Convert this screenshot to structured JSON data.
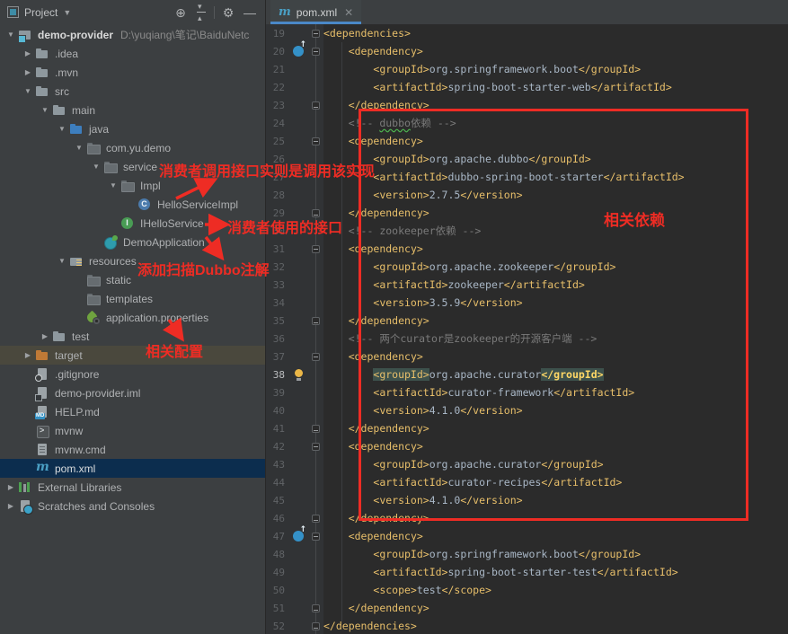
{
  "colors": {
    "panel_bg": "#3c3f41",
    "editor_bg": "#2b2b2b",
    "gutter_bg": "#313335",
    "annotation_red": "#EE2C24",
    "tab_underline": "#4A88C7",
    "tree_selection_bg": "#0C2D4E",
    "tree_highlight_row_bg": "#4A483D",
    "xml_tag_color": "#E8BF6A",
    "xml_text_color": "#A9B7C6",
    "comment_color": "#7A7A7A",
    "matched_tag_bg": "#3D514C",
    "maven_icon_color": "#4A9FC4"
  },
  "toolbar": {
    "project_label": "Project"
  },
  "tab": {
    "title": "pom.xml"
  },
  "tree": {
    "items": [
      {
        "label": "demo-provider",
        "path": "D:\\yuqiang\\笔记\\BaiduNetc",
        "level": 0,
        "exp": "v",
        "icon": "project-folder",
        "bold": true
      },
      {
        "label": ".idea",
        "level": 1,
        "exp": ">",
        "icon": "folder"
      },
      {
        "label": ".mvn",
        "level": 1,
        "exp": ">",
        "icon": "folder"
      },
      {
        "label": "src",
        "level": 1,
        "exp": "v",
        "icon": "folder"
      },
      {
        "label": "main",
        "level": 2,
        "exp": "v",
        "icon": "folder"
      },
      {
        "label": "java",
        "level": 3,
        "exp": "v",
        "icon": "source-folder"
      },
      {
        "label": "com.yu.demo",
        "level": 4,
        "exp": "v",
        "icon": "package"
      },
      {
        "label": "service",
        "level": 5,
        "exp": "v",
        "icon": "package"
      },
      {
        "label": "Impl",
        "level": 6,
        "exp": "v",
        "icon": "package"
      },
      {
        "label": "HelloServiceImpl",
        "level": 7,
        "exp": "",
        "icon": "class"
      },
      {
        "label": "IHelloService",
        "level": 6,
        "exp": "",
        "icon": "interface"
      },
      {
        "label": "DemoApplication",
        "level": 5,
        "exp": "",
        "icon": "springboot-class"
      },
      {
        "label": "resources",
        "level": 3,
        "exp": "v",
        "icon": "resources-folder"
      },
      {
        "label": "static",
        "level": 4,
        "exp": "",
        "icon": "package"
      },
      {
        "label": "templates",
        "level": 4,
        "exp": "",
        "icon": "package"
      },
      {
        "label": "application.properties",
        "level": 4,
        "exp": "",
        "icon": "spring-properties"
      },
      {
        "label": "test",
        "level": 2,
        "exp": ">",
        "icon": "folder"
      },
      {
        "label": "target",
        "level": 1,
        "exp": ">",
        "icon": "excluded-folder",
        "hl": true
      },
      {
        "label": ".gitignore",
        "level": 1,
        "exp": "",
        "icon": "gitignore-file"
      },
      {
        "label": "demo-provider.iml",
        "level": 1,
        "exp": "",
        "icon": "iml-file"
      },
      {
        "label": "HELP.md",
        "level": 1,
        "exp": "",
        "icon": "md-file"
      },
      {
        "label": "mvnw",
        "level": 1,
        "exp": "",
        "icon": "console-file"
      },
      {
        "label": "mvnw.cmd",
        "level": 1,
        "exp": "",
        "icon": "text-file"
      },
      {
        "label": "pom.xml",
        "level": 1,
        "exp": "",
        "icon": "maven-pom",
        "selected": true
      },
      {
        "label": "External Libraries",
        "level": 0,
        "exp": ">",
        "icon": "external-libraries"
      },
      {
        "label": "Scratches and Consoles",
        "level": 0,
        "exp": ">",
        "icon": "scratches"
      }
    ]
  },
  "editor": {
    "lines": [
      {
        "n": 19,
        "fold": "start",
        "ind": 0,
        "seg": [
          [
            "tag",
            "<dependencies>"
          ]
        ]
      },
      {
        "n": 20,
        "g": "maven",
        "fold": "start",
        "ind": 4,
        "seg": [
          [
            "tag",
            "<dependency>"
          ]
        ]
      },
      {
        "n": 21,
        "ind": 8,
        "seg": [
          [
            "tag",
            "<groupId>"
          ],
          [
            "txt",
            "org.springframework.boot"
          ],
          [
            "tag",
            "</groupId>"
          ]
        ]
      },
      {
        "n": 22,
        "ind": 8,
        "seg": [
          [
            "tag",
            "<artifactId>"
          ],
          [
            "txt",
            "spring-boot-starter-web"
          ],
          [
            "tag",
            "</artifactId>"
          ]
        ]
      },
      {
        "n": 23,
        "fold": "end",
        "ind": 4,
        "seg": [
          [
            "tag",
            "</dependency>"
          ]
        ]
      },
      {
        "n": 24,
        "ind": 4,
        "seg": [
          [
            "com",
            "<!-- "
          ],
          [
            "wavy",
            "dubbo"
          ],
          [
            "com",
            "依赖 -->"
          ]
        ]
      },
      {
        "n": 25,
        "fold": "start",
        "ind": 4,
        "seg": [
          [
            "tag",
            "<dependency>"
          ]
        ]
      },
      {
        "n": 26,
        "ind": 8,
        "seg": [
          [
            "tag",
            "<groupId>"
          ],
          [
            "txt",
            "org.apache.dubbo"
          ],
          [
            "tag",
            "</groupId>"
          ]
        ]
      },
      {
        "n": 27,
        "ind": 8,
        "seg": [
          [
            "tag",
            "<artifactId>"
          ],
          [
            "txt",
            "dubbo-spring-boot-starter"
          ],
          [
            "tag",
            "</artifactId>"
          ]
        ]
      },
      {
        "n": 28,
        "ind": 8,
        "seg": [
          [
            "tag",
            "<version>"
          ],
          [
            "txt",
            "2.7.5"
          ],
          [
            "tag",
            "</version>"
          ]
        ]
      },
      {
        "n": 29,
        "fold": "end",
        "ind": 4,
        "seg": [
          [
            "tag",
            "</dependency>"
          ]
        ]
      },
      {
        "n": 30,
        "ind": 4,
        "seg": [
          [
            "com",
            "<!-- zookeeper依赖 -->"
          ]
        ]
      },
      {
        "n": 31,
        "fold": "start",
        "ind": 4,
        "seg": [
          [
            "tag",
            "<dependency>"
          ]
        ]
      },
      {
        "n": 32,
        "ind": 8,
        "seg": [
          [
            "tag",
            "<groupId>"
          ],
          [
            "txt",
            "org.apache.zookeeper"
          ],
          [
            "tag",
            "</groupId>"
          ]
        ]
      },
      {
        "n": 33,
        "ind": 8,
        "seg": [
          [
            "tag",
            "<artifactId>"
          ],
          [
            "txt",
            "zookeeper"
          ],
          [
            "tag",
            "</artifactId>"
          ]
        ]
      },
      {
        "n": 34,
        "ind": 8,
        "seg": [
          [
            "tag",
            "<version>"
          ],
          [
            "txt",
            "3.5.9"
          ],
          [
            "tag",
            "</version>"
          ]
        ]
      },
      {
        "n": 35,
        "fold": "end",
        "ind": 4,
        "seg": [
          [
            "tag",
            "</dependency>"
          ]
        ]
      },
      {
        "n": 36,
        "ind": 4,
        "seg": [
          [
            "com",
            "<!-- 两个curator是zookeeper的开源客户端 -->"
          ]
        ]
      },
      {
        "n": 37,
        "fold": "start",
        "ind": 4,
        "seg": [
          [
            "tag",
            "<dependency>"
          ]
        ]
      },
      {
        "n": 38,
        "cur": true,
        "g": "bulb",
        "ind": 8,
        "seg": [
          [
            "hl",
            "<groupId>"
          ],
          [
            "txt",
            "org.apache.curator"
          ],
          [
            "hlb",
            "</groupId>"
          ]
        ]
      },
      {
        "n": 39,
        "ind": 8,
        "seg": [
          [
            "tag",
            "<artifactId>"
          ],
          [
            "txt",
            "curator-framework"
          ],
          [
            "tag",
            "</artifactId>"
          ]
        ]
      },
      {
        "n": 40,
        "ind": 8,
        "seg": [
          [
            "tag",
            "<version>"
          ],
          [
            "txt",
            "4.1.0"
          ],
          [
            "tag",
            "</version>"
          ]
        ]
      },
      {
        "n": 41,
        "fold": "end",
        "ind": 4,
        "seg": [
          [
            "tag",
            "</dependency>"
          ]
        ]
      },
      {
        "n": 42,
        "fold": "start",
        "ind": 4,
        "seg": [
          [
            "tag",
            "<dependency>"
          ]
        ]
      },
      {
        "n": 43,
        "ind": 8,
        "seg": [
          [
            "tag",
            "<groupId>"
          ],
          [
            "txt",
            "org.apache.curator"
          ],
          [
            "tag",
            "</groupId>"
          ]
        ]
      },
      {
        "n": 44,
        "ind": 8,
        "seg": [
          [
            "tag",
            "<artifactId>"
          ],
          [
            "txt",
            "curator-recipes"
          ],
          [
            "tag",
            "</artifactId>"
          ]
        ]
      },
      {
        "n": 45,
        "ind": 8,
        "seg": [
          [
            "tag",
            "<version>"
          ],
          [
            "txt",
            "4.1.0"
          ],
          [
            "tag",
            "</version>"
          ]
        ]
      },
      {
        "n": 46,
        "fold": "end",
        "ind": 4,
        "seg": [
          [
            "tag",
            "</dependency>"
          ]
        ]
      },
      {
        "n": 47,
        "g": "maven",
        "fold": "start",
        "ind": 4,
        "seg": [
          [
            "tag",
            "<dependency>"
          ]
        ]
      },
      {
        "n": 48,
        "ind": 8,
        "seg": [
          [
            "tag",
            "<groupId>"
          ],
          [
            "txt",
            "org.springframework.boot"
          ],
          [
            "tag",
            "</groupId>"
          ]
        ]
      },
      {
        "n": 49,
        "ind": 8,
        "seg": [
          [
            "tag",
            "<artifactId>"
          ],
          [
            "txt",
            "spring-boot-starter-test"
          ],
          [
            "tag",
            "</artifactId>"
          ]
        ]
      },
      {
        "n": 50,
        "ind": 8,
        "seg": [
          [
            "tag",
            "<scope>"
          ],
          [
            "txt",
            "test"
          ],
          [
            "tag",
            "</scope>"
          ]
        ]
      },
      {
        "n": 51,
        "fold": "end",
        "ind": 4,
        "seg": [
          [
            "tag",
            "</dependency>"
          ]
        ]
      },
      {
        "n": 52,
        "fold": "end",
        "ind": 0,
        "seg": [
          [
            "tag",
            "</dependencies>"
          ]
        ]
      }
    ]
  },
  "annotations": {
    "note_impl": "消费者调用接口实则是调用该实现",
    "note_interface": "消费者使用的接口",
    "note_dubbo_scan": "添加扫描Dubbo注解",
    "note_config": "相关配置",
    "note_deps": "相关依赖"
  }
}
